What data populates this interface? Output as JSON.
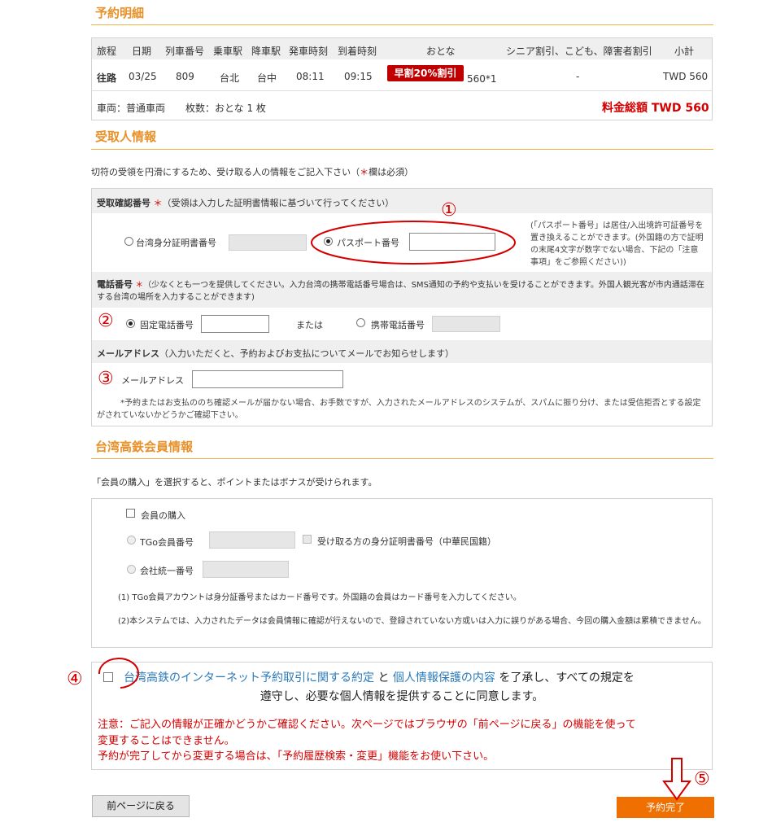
{
  "reservation": {
    "title": "予約明細",
    "headers": [
      "旅程",
      "日期",
      "列車番号",
      "乗車駅",
      "降車駅",
      "発車時刻",
      "到着時刻",
      "おとな",
      "シニア割引、こども、障害者割引",
      "小計"
    ],
    "row": {
      "trip": "往路",
      "date": "03/25",
      "train": "809",
      "from": "台北",
      "to": "台中",
      "depart": "08:11",
      "arrive": "09:15",
      "discount_badge": "早割20%割引",
      "adult": "560*1",
      "discount_fare": "-",
      "subtotal": "TWD 560"
    },
    "car_label": "車両：普通車両",
    "count_label": "枚数：おとな 1 枚",
    "total_label": "料金総額 TWD 560"
  },
  "recipient": {
    "title": "受取人情報",
    "intro_before": "切符の受領を円滑にするため、受け取る人の情報をご記入下さい（",
    "intro_star": "＊",
    "intro_after": "欄は必須）",
    "id_header_label": "受取確認番号",
    "required_mark": "＊",
    "id_header_note": "（受領は入力した証明書情報に基づいて行ってください）",
    "option_taiwan_id": "台湾身分証明書番号",
    "option_passport": "パスポート番号",
    "passport_value": "",
    "passport_note": "(「パスポート番号」は居住/入出境許可証番号を置き換えることができます。(外国籍の方で証明の末尾4文字が数字でない場合、下記の「注意事項」をご参照ください))",
    "phone_header_label": "電話番号",
    "phone_header_note": "（少なくとも一つを提供してください。入力台湾の携帯電話番号場合は、SMS通知の予約や支払いを受けることができます。外国人観光客が市内通話滞在する台湾の場所を入力することができます)",
    "option_landline": "固定電話番号",
    "landline_value": "",
    "or_label": "または",
    "option_mobile": "携帯電話番号",
    "email_header_label": "メールアドレス",
    "email_header_note": "（入力いただくと、予約およびお支払についてメールでお知らせします）",
    "email_label": "メールアドレス",
    "email_value": "",
    "email_note": "*予約またはお支払ののち確認メールが届かない場合、お手数ですが、入力されたメールアドレスのシステムが、スパムに振り分け、または受信拒否とする設定がされていないかどうかご確認下さい。"
  },
  "member": {
    "title": "台湾高鉄会員情報",
    "intro": "「会員の購入」を選択すると、ポイントまたはボナスが受けられます。",
    "purchase_label": "会員の購入",
    "tgo_label": "TGo会員番号",
    "recipient_id_label": "受け取る方の身分証明書番号（中華民国籍）",
    "company_label": "会社統一番号",
    "note1": "(1) TGo会員アカウントは身分証番号またはカード番号です。外国籍の会員はカード番号を入力してください。",
    "note2": "(2)本システムでは、入力されたデータは会員情報に確認が行えないので、登録されていない方或いは入力に誤りがある場合、今回の購入金額は累積できません。"
  },
  "agreement": {
    "link_terms": "台湾高鉄のインターネット予約取引に関する約定",
    "and": "と",
    "link_privacy": "個人情報保護の内容",
    "text_after": "を了承し、すべての規定を",
    "text_line2": "遵守し、必要な個人情報を提供することに同意します。",
    "warning1": "注意：ご記入の情報が正確かどうかご確認ください。次ページではブラウザの「前ページに戻る」の機能を使って",
    "warning2": "変更することはできません。",
    "warning3": "予約が完了してから変更する場合は、「予約履歴検索・変更」機能をお使い下さい。"
  },
  "buttons": {
    "back": "前ページに戻る",
    "complete": "予約完了"
  },
  "annotations": {
    "n1": "①",
    "n2": "②",
    "n3": "③",
    "n4": "④",
    "n5": "⑤"
  },
  "colors": {
    "accent": "#e8912a",
    "required": "#d40000",
    "link": "#2a7ab8",
    "primary_button": "#ef7000",
    "badge": "#c00000"
  }
}
